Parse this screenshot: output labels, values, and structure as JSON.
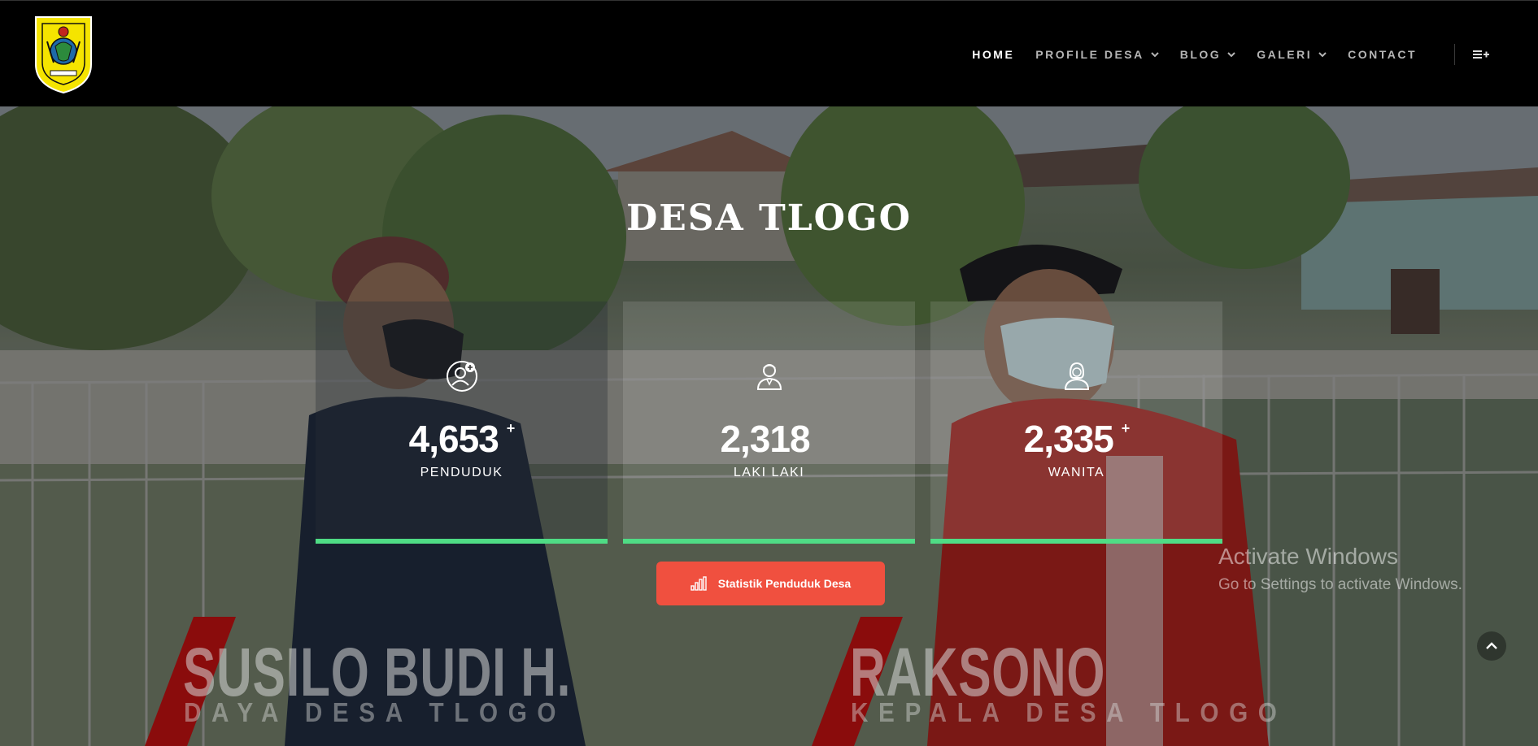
{
  "nav": {
    "items": [
      {
        "label": "HOME",
        "active": true,
        "dropdown": false
      },
      {
        "label": "PROFILE DESA",
        "active": false,
        "dropdown": true
      },
      {
        "label": "BLOG",
        "active": false,
        "dropdown": true
      },
      {
        "label": "GALERI",
        "active": false,
        "dropdown": true
      },
      {
        "label": "CONTACT",
        "active": false,
        "dropdown": false
      }
    ],
    "menu_icon": "menu-plus-icon"
  },
  "hero": {
    "title": "DESA TLOGO",
    "stats": [
      {
        "icon": "user-plus-icon",
        "value": "4,653",
        "plus": "+",
        "label": "PENDUDUK"
      },
      {
        "icon": "user-male-icon",
        "value": "2,318",
        "plus": "",
        "label": "LAKI LAKI"
      },
      {
        "icon": "user-female-icon",
        "value": "2,335",
        "plus": "+",
        "label": "WANITA"
      }
    ],
    "button_label": "Statistik Penduduk Desa",
    "captions": [
      {
        "name": "SUSILO BUDI H.",
        "role": "DAYA DESA TLOGO"
      },
      {
        "name": "RAKSONO",
        "role": "KEPALA DESA TLOGO"
      }
    ]
  },
  "watermark": {
    "line1": "Activate Windows",
    "line2": "Go to Settings to activate Windows."
  },
  "colors": {
    "accent_green": "#4fdc85",
    "button_red": "#f0503f",
    "logo_yellow": "#f5e400"
  }
}
